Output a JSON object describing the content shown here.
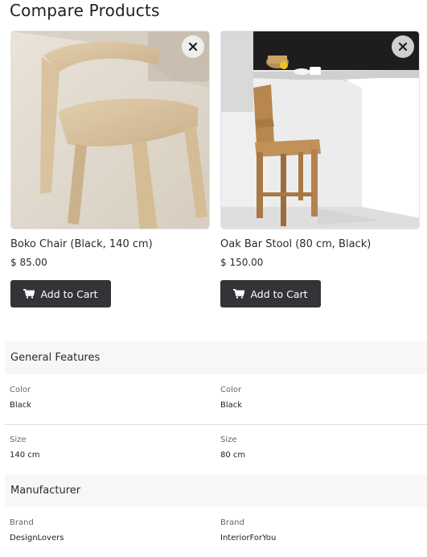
{
  "page": {
    "title": "Compare Products"
  },
  "products": [
    {
      "name": "Boko Chair (Black, 140 cm)",
      "price": "$ 85.00",
      "cart_label": "Add to Cart",
      "image_icon": "chair-photo",
      "remove_icon": "close-icon"
    },
    {
      "name": "Oak Bar Stool (80 cm, Black)",
      "price": "$ 150.00",
      "cart_label": "Add to Cart",
      "image_icon": "bar-stool-photo",
      "remove_icon": "close-icon"
    }
  ],
  "sections": [
    {
      "title": "General Features",
      "attributes": [
        {
          "label": "Color",
          "values": [
            "Black",
            "Black"
          ]
        },
        {
          "label": "Size",
          "values": [
            "140 cm",
            "80 cm"
          ]
        }
      ]
    },
    {
      "title": "Manufacturer",
      "attributes": [
        {
          "label": "Brand",
          "values": [
            "DesignLovers",
            "InteriorForYou"
          ]
        }
      ]
    }
  ],
  "colors": {
    "button_bg": "#333338",
    "section_bg": "#f7f7f7"
  }
}
